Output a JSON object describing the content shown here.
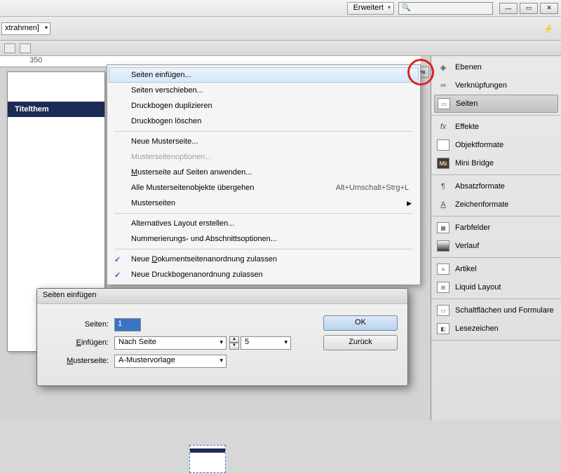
{
  "titlebar": {
    "mode": "Erweitert"
  },
  "controlbar": {
    "frame_label": "xtrahmen]"
  },
  "ruler": {
    "mark": "350"
  },
  "document": {
    "banner": "Titelthem"
  },
  "context_menu": {
    "insert": "Seiten einfügen...",
    "move": "Seiten verschieben...",
    "dup": "Druckbogen duplizieren",
    "del": "Druckbogen löschen",
    "newmaster": "Neue Musterseite...",
    "masteropts": "Musterseitenoptionen...",
    "applymaster_pre": "M",
    "applymaster_post": "usterseite auf Seiten anwenden...",
    "override": "Alle Musterseitenobjekte übergehen",
    "override_sc": "Alt+Umschalt+Strg+L",
    "masters": "Musterseiten",
    "altlayout": "Alternatives Layout erstellen...",
    "numbering": "Nummerierungs- und Abschnittsoptionen...",
    "allow_doc_pre": "Neue ",
    "allow_doc_u": "D",
    "allow_doc_post": "okumentseitenanordnung zulassen",
    "allow_spread": "Neue Druckbogenanordnung zulassen"
  },
  "panels": {
    "ebenen": "Ebenen",
    "verkn": "Verknüpfungen",
    "seiten": "Seiten",
    "effekte": "Effekte",
    "objfmt": "Objektformate",
    "minibr": "Mini Bridge",
    "absatz": "Absatzformate",
    "zeichen": "Zeichenformate",
    "farb": "Farbfelder",
    "verlauf": "Verlauf",
    "artikel": "Artikel",
    "liquid": "Liquid Layout",
    "schalt": "Schaltflächen und Formulare",
    "lese": "Lesezeichen"
  },
  "dialog": {
    "title": "Seiten einfügen",
    "seiten_label": "Seiten:",
    "seiten_val": "1",
    "einf_label_u": "E",
    "einf_label_post": "infügen:",
    "einf_val": "Nach Seite",
    "einf_num": "5",
    "muster_label_u": "M",
    "muster_label_post": "usterseite:",
    "muster_val": "A-Mustervorlage",
    "ok": "OK",
    "cancel": "Zurück"
  }
}
